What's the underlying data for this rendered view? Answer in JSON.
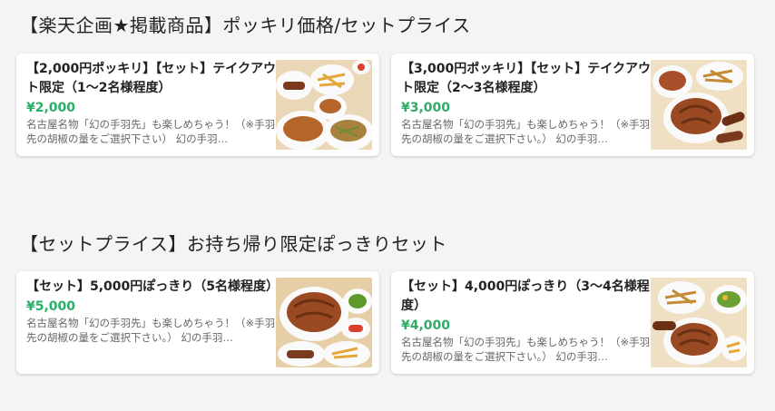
{
  "sections": [
    {
      "title": "【楽天企画★掲載商品】ポッキリ価格/セットプライス",
      "cards": [
        {
          "title": "【2,000円ポッキリ】【セット】テイクアウト限定（1～2名様程度）",
          "price": "¥2,000",
          "description": "名古屋名物「幻の手羽先」も楽しめちゃう！（※手羽先の胡椒の量をご選択下さい） 幻の手羽…"
        },
        {
          "title": "【3,000円ポッキリ】【セット】テイクアウト限定（2～3名様程度）",
          "price": "¥3,000",
          "description": "名古屋名物「幻の手羽先」も楽しめちゃう！（※手羽先の胡椒の量をご選択下さい。） 幻の手羽…"
        }
      ]
    },
    {
      "title": "【セットプライス】お持ち帰り限定ぽっきりセット",
      "cards": [
        {
          "title": "【セット】5,000円ぽっきり（5名様程度）",
          "price": "¥5,000",
          "description": "名古屋名物「幻の手羽先」も楽しめちゃう！（※手羽先の胡椒の量をご選択下さい。） 幻の手羽…"
        },
        {
          "title": "【セット】4,000円ぽっきり（3～4名様程度）",
          "price": "¥4,000",
          "description": "名古屋名物「幻の手羽先」も楽しめちゃう！（※手羽先の胡椒の量をご選択下さい。） 幻の手羽…"
        }
      ]
    }
  ],
  "colors": {
    "price": "#2bae66",
    "background": "#f4f4f4",
    "card": "#ffffff"
  }
}
